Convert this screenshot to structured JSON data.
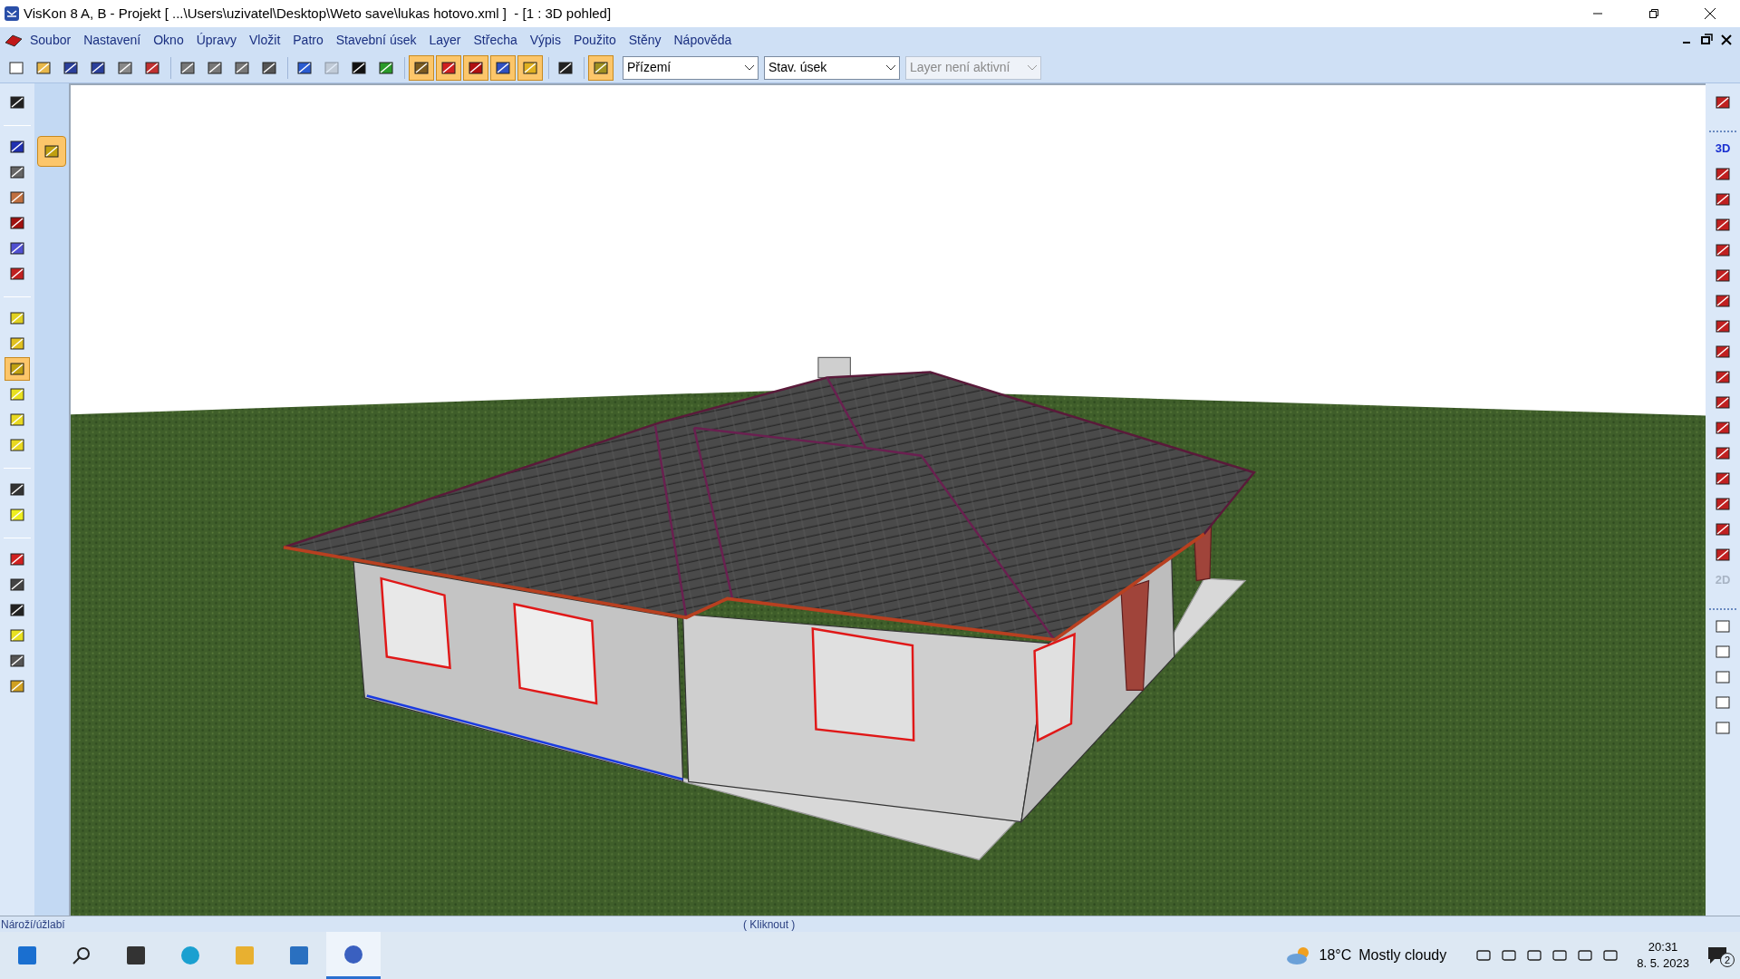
{
  "window": {
    "title": "VisKon 8 A, B - Projekt [ ...\\Users\\uzivatel\\Desktop\\Weto save\\lukas hotovo.xml ]  - [1 : 3D pohled]"
  },
  "menu": [
    "Soubor",
    "Nastavení",
    "Okno",
    "Úpravy",
    "Vložit",
    "Patro",
    "Stavební úsek",
    "Layer",
    "Střecha",
    "Výpis",
    "Použito",
    "Stěny",
    "Nápověda"
  ],
  "toolbar": {
    "tools": [
      {
        "selected": false,
        "disabled": false
      },
      {
        "selected": false,
        "disabled": false
      },
      {
        "selected": false,
        "disabled": false
      },
      {
        "selected": false,
        "disabled": false
      },
      {
        "selected": false,
        "disabled": false
      },
      {
        "selected": false,
        "disabled": false
      },
      {
        "selected": false,
        "disabled": false
      },
      {
        "selected": false,
        "disabled": false
      },
      {
        "selected": false,
        "disabled": false
      },
      {
        "selected": false,
        "disabled": false
      },
      {
        "selected": false,
        "disabled": false
      },
      {
        "selected": false,
        "disabled": true
      },
      {
        "selected": false,
        "disabled": false
      },
      {
        "selected": false,
        "disabled": false
      },
      {
        "selected": true,
        "disabled": false
      },
      {
        "selected": true,
        "disabled": false
      },
      {
        "selected": true,
        "disabled": false
      },
      {
        "selected": true,
        "disabled": false
      },
      {
        "selected": true,
        "disabled": false
      },
      {
        "selected": false,
        "disabled": false
      },
      {
        "selected": true,
        "disabled": false
      }
    ],
    "dropdowns": [
      {
        "value": "Přízemí",
        "disabled": false
      },
      {
        "value": "Stav. úsek",
        "disabled": false
      },
      {
        "value": "Layer není aktivní",
        "disabled": true
      }
    ]
  },
  "left_toolbar": [
    {
      "selected": false
    },
    {
      "selected": false
    },
    {
      "selected": false
    },
    {
      "selected": false
    },
    {
      "selected": false
    },
    {
      "selected": false
    },
    {
      "selected": false
    },
    {
      "selected": false
    },
    {
      "selected": false
    },
    {
      "selected": true
    },
    {
      "selected": false
    },
    {
      "selected": false
    },
    {
      "selected": false
    },
    {
      "selected": false
    },
    {
      "selected": false
    },
    {
      "selected": false
    },
    {
      "selected": false
    },
    {
      "selected": false
    },
    {
      "selected": false
    },
    {
      "selected": false
    },
    {
      "selected": false
    }
  ],
  "flyout": {
    "selected": true
  },
  "right_toolbar": [
    {
      "kind": "icon",
      "disabled": false
    },
    {
      "kind": "text",
      "label": "3D",
      "disabled": false
    },
    {
      "kind": "icon",
      "disabled": false
    },
    {
      "kind": "icon",
      "disabled": false
    },
    {
      "kind": "icon",
      "disabled": false
    },
    {
      "kind": "icon",
      "disabled": false
    },
    {
      "kind": "icon",
      "disabled": false
    },
    {
      "kind": "icon",
      "disabled": false
    },
    {
      "kind": "icon",
      "disabled": false
    },
    {
      "kind": "icon",
      "disabled": false
    },
    {
      "kind": "icon",
      "disabled": false
    },
    {
      "kind": "icon",
      "disabled": false
    },
    {
      "kind": "icon",
      "disabled": false
    },
    {
      "kind": "icon",
      "disabled": false
    },
    {
      "kind": "icon",
      "disabled": false
    },
    {
      "kind": "icon",
      "disabled": false
    },
    {
      "kind": "icon",
      "disabled": false
    },
    {
      "kind": "icon",
      "disabled": false
    },
    {
      "kind": "text",
      "label": "2D",
      "disabled": true
    },
    {
      "kind": "icon",
      "disabled": false
    },
    {
      "kind": "icon",
      "disabled": false
    },
    {
      "kind": "icon",
      "disabled": false
    },
    {
      "kind": "icon",
      "disabled": false
    },
    {
      "kind": "icon",
      "disabled": false
    }
  ],
  "status_bar": {
    "left": "Nároží/úžlabí",
    "center": "( Kliknout )"
  },
  "taskbar": {
    "apps": [
      {
        "selected": false
      },
      {
        "selected": false
      },
      {
        "selected": false
      },
      {
        "selected": false
      },
      {
        "selected": true
      }
    ],
    "weather": {
      "temperature": "18°C",
      "condition": "Mostly cloudy"
    },
    "time": "20:31",
    "date": "8. 5. 2023",
    "notifications": "2"
  }
}
